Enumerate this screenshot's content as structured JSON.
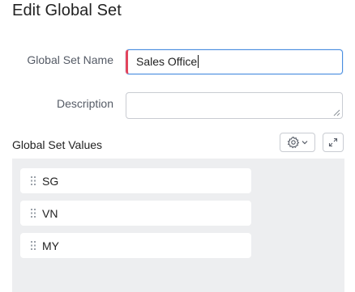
{
  "form": {
    "title": "Edit Global Set",
    "name_label": "Global Set Name",
    "name_value": "Sales Office",
    "description_label": "Description",
    "description_value": ""
  },
  "values_section": {
    "title": "Global Set Values",
    "settings_icon": "gear-icon",
    "expand_icon": "expand-icon",
    "items": [
      {
        "label": "SG"
      },
      {
        "label": "VN"
      },
      {
        "label": "MY"
      }
    ]
  },
  "colors": {
    "required_marker": "#e2445c",
    "focus_border": "#4a8ee0",
    "panel_background": "#edeef0"
  }
}
